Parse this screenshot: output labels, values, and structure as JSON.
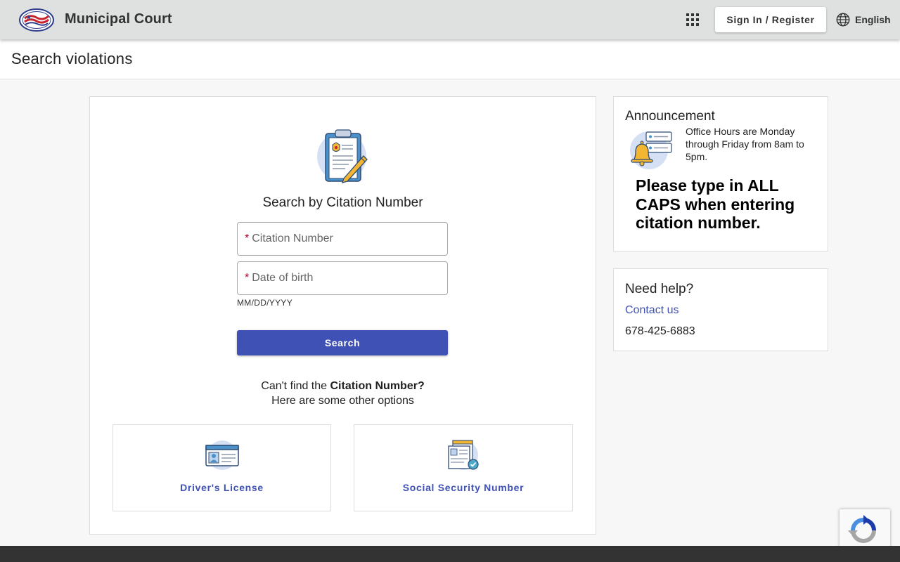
{
  "header": {
    "app_title": "Municipal Court",
    "signin_label": "Sign In / Register",
    "language_label": "English",
    "logo_icon": "court-seal-logo",
    "apps_icon": "apps-grid-icon",
    "globe_icon": "globe-icon"
  },
  "page": {
    "title": "Search violations"
  },
  "search": {
    "heading": "Search by Citation Number",
    "citation_placeholder": "Citation Number",
    "dob_placeholder": "Date of birth",
    "required_marker": "*",
    "dob_hint": "MM/DD/YYYY",
    "button_label": "Search",
    "cant_find_prefix": "Can't find the ",
    "cant_find_bold": "Citation Number?",
    "cant_find_line2": "Here are some other options",
    "options": [
      {
        "label": "Driver's License",
        "icon": "id-card-icon"
      },
      {
        "label": "Social Security Number",
        "icon": "documents-check-icon"
      }
    ]
  },
  "announcement": {
    "title": "Announcement",
    "text": "Office Hours are Monday through Friday from 8am to 5pm.",
    "bold_text": "Please type in ALL CAPS when entering citation number."
  },
  "help": {
    "title": "Need help?",
    "link_label": "Contact us",
    "phone": "678-425-6883"
  },
  "colors": {
    "accent": "#3f51b5",
    "header_bg": "#dfe1e1",
    "footer_bg": "#333333",
    "required": "#b00020"
  }
}
